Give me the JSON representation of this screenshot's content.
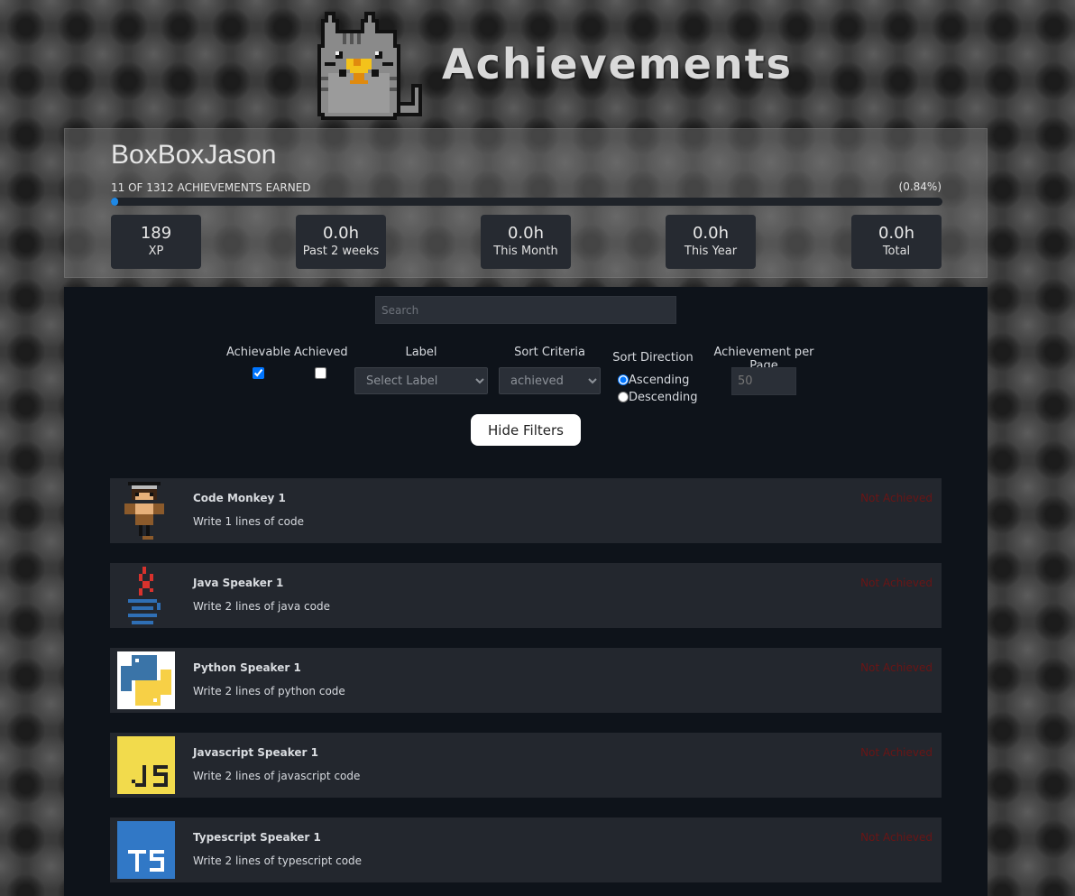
{
  "header": {
    "title": "Achievements",
    "mascot_icon": "pixel-cat-with-trophy-icon"
  },
  "profile": {
    "username": "BoxBoxJason",
    "earned_text": "11 OF 1312 ACHIEVEMENTS EARNED",
    "percent_text": "(0.84%)",
    "progress_fraction": 0.0084,
    "stats": [
      {
        "value": "189",
        "label": "XP"
      },
      {
        "value": "0.0h",
        "label": "Past 2 weeks"
      },
      {
        "value": "0.0h",
        "label": "This Month"
      },
      {
        "value": "0.0h",
        "label": "This Year"
      },
      {
        "value": "0.0h",
        "label": "Total"
      }
    ]
  },
  "filters": {
    "search_placeholder": "Search",
    "achievable_label": "Achievable",
    "achieved_label": "Achieved",
    "label_label": "Label",
    "label_select_value": "Select Label",
    "sort_criteria_label": "Sort Criteria",
    "sort_criteria_value": "achieved",
    "sort_direction_label": "Sort Direction",
    "ascending_label": "Ascending",
    "descending_label": "Descending",
    "per_page_label": "Achievement per Page",
    "per_page_placeholder": "50",
    "hide_filters_label": "Hide Filters"
  },
  "achievements": [
    {
      "name": "Code Monkey 1",
      "description": "Write 1 lines of code",
      "status": "Not Achieved",
      "icon": "monkey-icon"
    },
    {
      "name": "Java Speaker 1",
      "description": "Write 2 lines of java code",
      "status": "Not Achieved",
      "icon": "java-icon"
    },
    {
      "name": "Python Speaker 1",
      "description": "Write 2 lines of python code",
      "status": "Not Achieved",
      "icon": "python-icon"
    },
    {
      "name": "Javascript Speaker 1",
      "description": "Write 2 lines of javascript code",
      "status": "Not Achieved",
      "icon": "javascript-icon"
    },
    {
      "name": "Typescript Speaker 1",
      "description": "Write 2 lines of typescript code",
      "status": "Not Achieved",
      "icon": "typescript-icon"
    }
  ],
  "colors": {
    "accent": "#1e88e5",
    "not_achieved": "#6a1515",
    "panel": "#0e131a",
    "card": "#23272e"
  }
}
